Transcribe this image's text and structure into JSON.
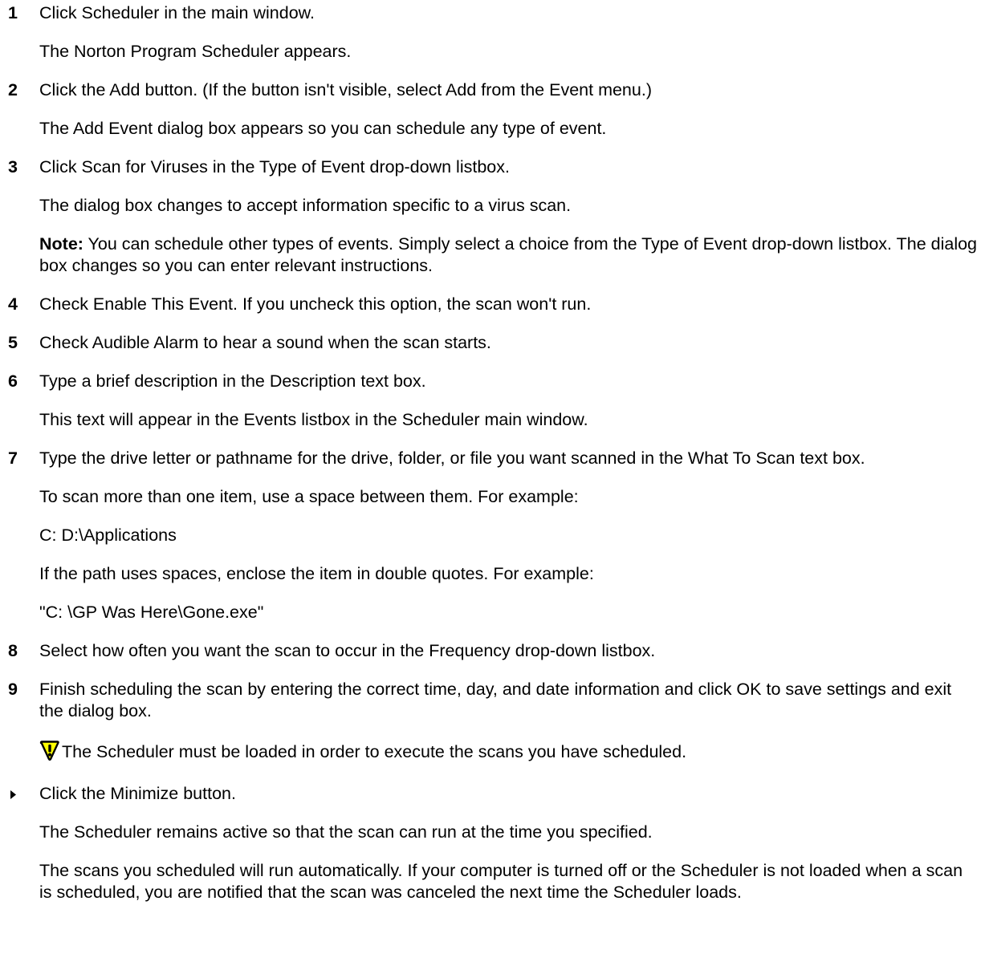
{
  "steps": [
    {
      "num": "1",
      "text": "Click Scheduler in the main window.",
      "follow": [
        "The Norton Program Scheduler appears."
      ]
    },
    {
      "num": "2",
      "text": "Click the Add button. (If the button isn't visible, select Add from the Event menu.)",
      "follow": [
        "The Add Event dialog box appears so you can schedule any type of event."
      ]
    },
    {
      "num": "3",
      "text": "Click Scan for Viruses in the Type of Event drop-down listbox.",
      "follow": [
        "The dialog box changes to accept information specific to a virus scan."
      ],
      "note_label": "Note:",
      "note_text": " You can schedule other types of events. Simply select a choice from the Type of Event drop-down listbox. The dialog box changes so you can enter relevant instructions."
    },
    {
      "num": "4",
      "text": "Check Enable This Event. If you uncheck this option, the scan won't run."
    },
    {
      "num": "5",
      "text": "Check Audible Alarm to hear a sound when the scan starts."
    },
    {
      "num": "6",
      "text": "Type a brief description in the Description text box.",
      "follow": [
        "This text will appear in the Events listbox in the Scheduler main window."
      ]
    },
    {
      "num": "7",
      "text": "Type the drive letter or pathname for the drive, folder, or file you want scanned in the What To Scan text box.",
      "follow": [
        "To scan more than one item, use a space between them. For example:",
        "C: D:\\Applications",
        "If the path uses spaces, enclose the item in double quotes. For example:",
        "\"C: \\GP Was Here\\Gone.exe\""
      ]
    },
    {
      "num": "8",
      "text": "Select how often you want the scan to occur in the Frequency drop-down listbox."
    },
    {
      "num": "9",
      "text": "Finish scheduling the scan by entering the correct time, day, and date information and click OK to save settings and exit the dialog box."
    }
  ],
  "warning": {
    "icon": "warning-exclamation-icon",
    "text": "The Scheduler must be loaded in order to execute the scans you have scheduled."
  },
  "bullet_step": {
    "icon": "triangle-bullet-icon",
    "text": "Click the Minimize button.",
    "follow": [
      "The Scheduler remains active so that the scan can run at the time you specified.",
      "The scans you scheduled will run automatically. If your computer is turned off or the Scheduler is not loaded when a scan is scheduled, you are notified that the scan was canceled the next time the Scheduler loads."
    ]
  },
  "colors": {
    "text": "#000000",
    "warning_fill": "#ffff00",
    "warning_stroke": "#000000"
  }
}
